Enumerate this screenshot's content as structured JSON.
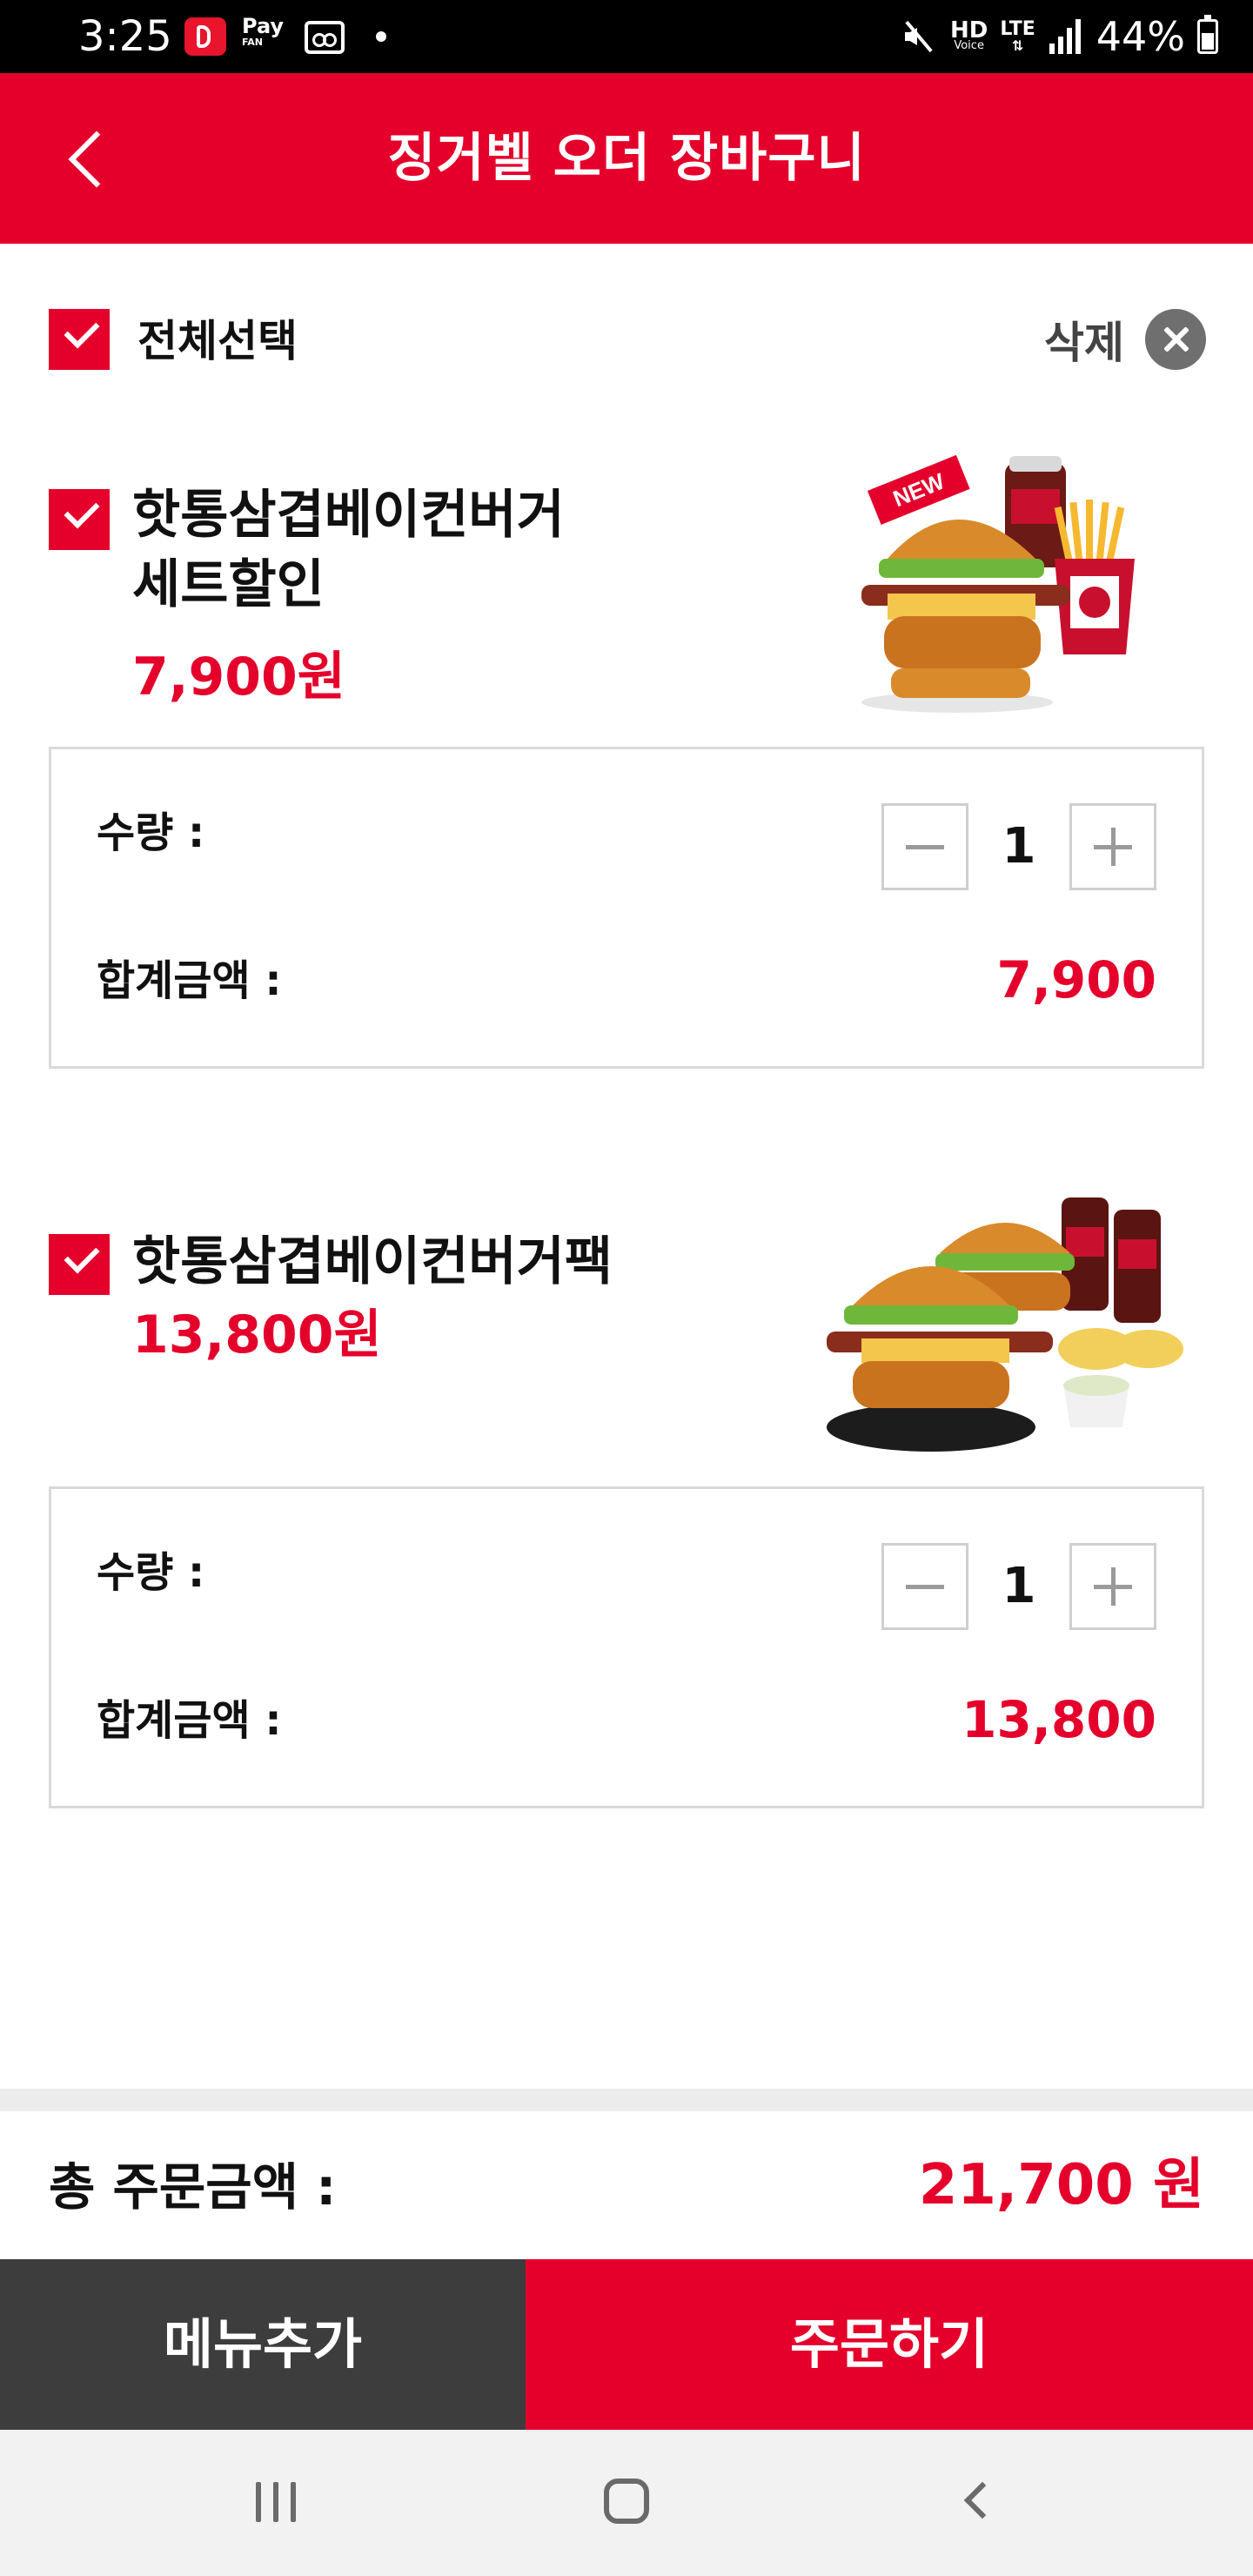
{
  "status_bar": {
    "time": "3:25",
    "pay_label": "Pay",
    "fan_label": "FAN",
    "hd_label": "HD",
    "voice_label": "Voice",
    "lte_label": "LTE",
    "battery_percent": "44%"
  },
  "header": {
    "title": "징거벨 오더 장바구니"
  },
  "select_all": {
    "label": "전체선택",
    "checked": true,
    "delete_label": "삭제"
  },
  "items": [
    {
      "name_line1": "핫통삼겹베이컨버거",
      "name_line2": "세트할인",
      "price": "7,900원",
      "checked": true,
      "image_icon": "burger-set-image",
      "badge": "NEW",
      "quantity_label": "수량 :",
      "quantity": "1",
      "subtotal_label": "합계금액 :",
      "subtotal": "7,900"
    },
    {
      "name_line1": "핫통삼겹베이컨버거팩",
      "price": "13,800원",
      "checked": true,
      "image_icon": "burger-pack-image",
      "quantity_label": "수량 :",
      "quantity": "1",
      "subtotal_label": "합계금액 :",
      "subtotal": "13,800"
    }
  ],
  "total": {
    "label": "총 주문금액 :",
    "value": "21,700 원"
  },
  "actions": {
    "add_menu": "메뉴추가",
    "order": "주문하기"
  },
  "colors": {
    "brand_red": "#e4002b",
    "dark_button": "#3d3d3d"
  }
}
